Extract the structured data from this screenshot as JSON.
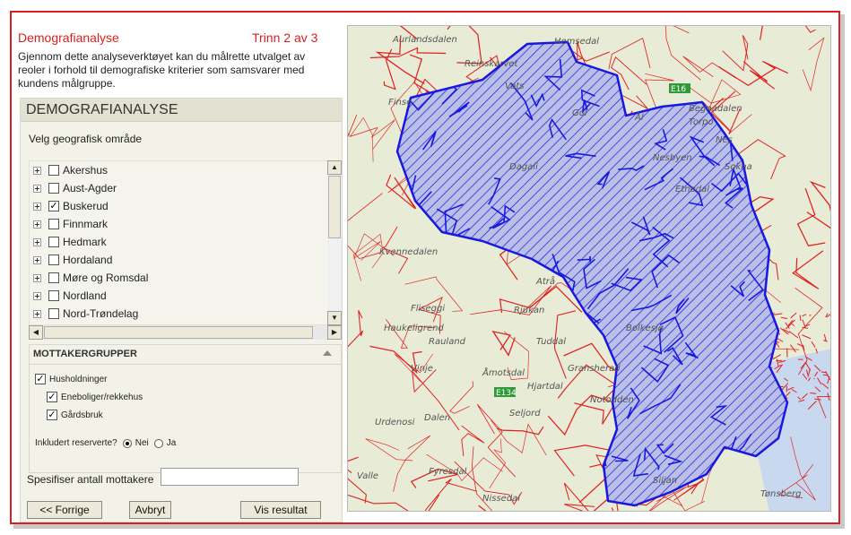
{
  "header": {
    "title": "Demografianalyse",
    "step": "Trinn 2 av 3",
    "intro": "Gjennom dette analyseverktøyet kan du målrette utvalget av reoler i forhold til demografiske kriterier som samsvarer med kundens målgruppe."
  },
  "panel": {
    "heading": "DEMOGRAFIANALYSE",
    "area_label": "Velg geografisk område",
    "regions": [
      {
        "label": "Akershus",
        "checked": false
      },
      {
        "label": "Aust-Agder",
        "checked": false
      },
      {
        "label": "Buskerud",
        "checked": true
      },
      {
        "label": "Finnmark",
        "checked": false
      },
      {
        "label": "Hedmark",
        "checked": false
      },
      {
        "label": "Hordaland",
        "checked": false
      },
      {
        "label": "Møre og Romsdal",
        "checked": false
      },
      {
        "label": "Nordland",
        "checked": false
      },
      {
        "label": "Nord-Trøndelag",
        "checked": false
      }
    ],
    "check_mark": "✓",
    "scroll_up": "▲",
    "scroll_down": "▼",
    "scroll_left": "◀",
    "scroll_right": "▶"
  },
  "recipients": {
    "heading": "MOTTAKERGRUPPER",
    "households": {
      "label": "Husholdninger",
      "checked": true
    },
    "detached": {
      "label": "Eneboliger/rekkehus",
      "checked": true
    },
    "farms": {
      "label": "Gårdsbruk",
      "checked": true
    },
    "reserved_question": "Inkludert reserverte?",
    "options": [
      {
        "label": "Nei",
        "selected": true
      },
      {
        "label": "Ja",
        "selected": false
      }
    ]
  },
  "specify": {
    "label": "Spesifiser antall mottakere",
    "value": ""
  },
  "buttons": {
    "back": "<< Forrige",
    "cancel": "Avbryt",
    "show_result": "Vis resultat"
  },
  "map": {
    "place_names": [
      "Aurlandsdalen",
      "Hemsedal",
      "Reinskarvet",
      "Vats",
      "Finse",
      "Gol",
      "Ål",
      "Torpo",
      "Dagali",
      "Nesbyen",
      "Etnedal",
      "Begnadalen",
      "Nes",
      "Sokna",
      "Kvennedalen",
      "Atrå",
      "Rjukan",
      "Fliseggi",
      "Haukeligrend",
      "Rauland",
      "Tuddal",
      "Bolkesjø",
      "Hjartdal",
      "Seljord",
      "Dalen",
      "Urdenosi",
      "Vinje",
      "Åmotsdal",
      "Gransherad",
      "Notodden",
      "Fyresdal",
      "Valle",
      "Nissedal",
      "Siljan",
      "Tønsberg",
      "E16",
      "E134"
    ],
    "colors": {
      "district": "#1818e0",
      "roads": "#e02020",
      "terrain": "#e8ecd6",
      "water": "#c8d8ee"
    }
  }
}
